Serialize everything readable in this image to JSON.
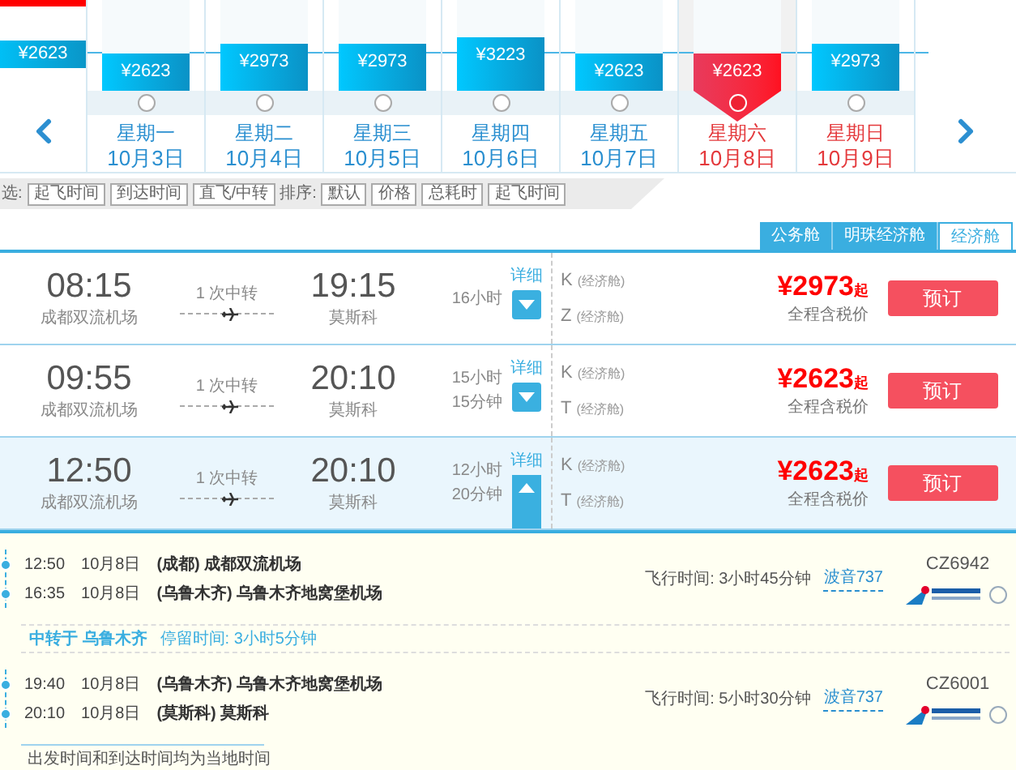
{
  "date_strip": {
    "partial_day": {
      "price": "¥2623"
    },
    "days": [
      {
        "price": "¥2623",
        "level": 0.41,
        "weekday": "星期一",
        "date": "10月3日",
        "selected": false,
        "weekend": false
      },
      {
        "price": "¥2973",
        "level": 0.52,
        "weekday": "星期二",
        "date": "10月4日",
        "selected": false,
        "weekend": false
      },
      {
        "price": "¥2973",
        "level": 0.52,
        "weekday": "星期三",
        "date": "10月5日",
        "selected": false,
        "weekend": false
      },
      {
        "price": "¥3223",
        "level": 0.59,
        "weekday": "星期四",
        "date": "10月6日",
        "selected": false,
        "weekend": false
      },
      {
        "price": "¥2623",
        "level": 0.41,
        "weekday": "星期五",
        "date": "10月7日",
        "selected": false,
        "weekend": false
      },
      {
        "price": "¥2623",
        "level": 0.41,
        "weekday": "星期六",
        "date": "10月8日",
        "selected": true,
        "weekend": true
      },
      {
        "price": "¥2973",
        "level": 0.52,
        "weekday": "星期日",
        "date": "10月9日",
        "selected": false,
        "weekend": true
      }
    ]
  },
  "filter_bar": {
    "filter_label": "选:",
    "filters": [
      "起飞时间",
      "到达时间",
      "直飞/中转"
    ],
    "sort_label": "排序:",
    "sorts": [
      "默认",
      "价格",
      "总耗时",
      "起飞时间"
    ]
  },
  "cabin_tabs": [
    {
      "label": "公务舱",
      "selected": false
    },
    {
      "label": "明珠经济舱",
      "selected": false
    },
    {
      "label": "经济舱",
      "selected": true
    }
  ],
  "flights": [
    {
      "depart_time": "08:15",
      "depart_airport": "成都双流机场",
      "transfer": "1 次中转",
      "arrive_time": "19:15",
      "arrive_airport": "莫斯科",
      "duration": [
        "16小时"
      ],
      "detail_label": "详细",
      "expanded": false,
      "classes": [
        {
          "code": "K",
          "name": "(经济舱)"
        },
        {
          "code": "Z",
          "name": "(经济舱)"
        }
      ],
      "price": "¥2973",
      "price_suffix": "起",
      "price_note": "全程含税价",
      "book": "预订"
    },
    {
      "depart_time": "09:55",
      "depart_airport": "成都双流机场",
      "transfer": "1 次中转",
      "arrive_time": "20:10",
      "arrive_airport": "莫斯科",
      "duration": [
        "15小时",
        "15分钟"
      ],
      "detail_label": "详细",
      "expanded": false,
      "classes": [
        {
          "code": "K",
          "name": "(经济舱)"
        },
        {
          "code": "T",
          "name": "(经济舱)"
        }
      ],
      "price": "¥2623",
      "price_suffix": "起",
      "price_note": "全程含税价",
      "book": "预订"
    },
    {
      "depart_time": "12:50",
      "depart_airport": "成都双流机场",
      "transfer": "1 次中转",
      "arrive_time": "20:10",
      "arrive_airport": "莫斯科",
      "duration": [
        "12小时",
        "20分钟"
      ],
      "detail_label": "详细",
      "expanded": true,
      "classes": [
        {
          "code": "K",
          "name": "(经济舱)"
        },
        {
          "code": "T",
          "name": "(经济舱)"
        }
      ],
      "price": "¥2623",
      "price_suffix": "起",
      "price_note": "全程含税价",
      "book": "预订"
    }
  ],
  "details": {
    "segments": [
      {
        "stops": [
          {
            "time": "12:50",
            "date": "10月8日",
            "airport": "(成都) 成都双流机场"
          },
          {
            "time": "16:35",
            "date": "10月8日",
            "airport": "(乌鲁木齐) 乌鲁木齐地窝堡机场"
          }
        ],
        "flight_time": "飞行时间: 3小时45分钟",
        "aircraft": "波音737",
        "flight_no": "CZ6942"
      },
      {
        "stops": [
          {
            "time": "19:40",
            "date": "10月8日",
            "airport": "(乌鲁木齐) 乌鲁木齐地窝堡机场"
          },
          {
            "time": "20:10",
            "date": "10月8日",
            "airport": "(莫斯科) 莫斯科"
          }
        ],
        "flight_time": "飞行时间: 5小时30分钟",
        "aircraft": "波音737",
        "flight_no": "CZ6001"
      }
    ],
    "transfer": {
      "place": "中转于 乌鲁木齐",
      "stay": "停留时间: 3小时5分钟"
    },
    "note": "出发时间和到达时间均为当地时间"
  }
}
